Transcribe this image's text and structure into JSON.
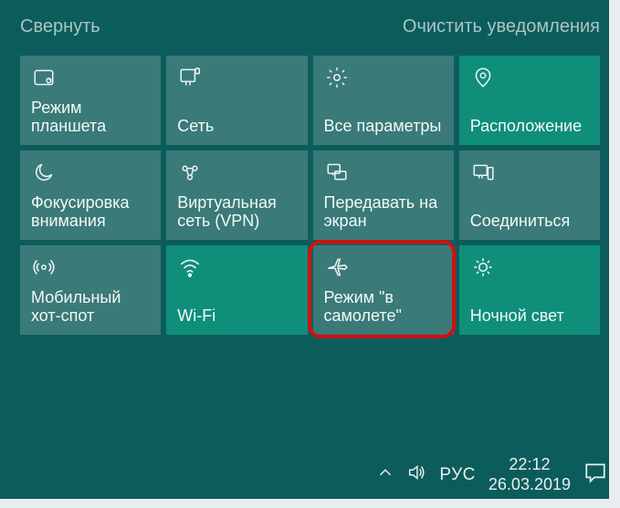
{
  "header": {
    "collapse_label": "Свернуть",
    "clear_label": "Очистить уведомления"
  },
  "tiles": [
    {
      "id": "tablet-mode",
      "label": "Режим планшета",
      "active": false
    },
    {
      "id": "network",
      "label": "Сеть",
      "active": false
    },
    {
      "id": "all-settings",
      "label": "Все параметры",
      "active": false
    },
    {
      "id": "location",
      "label": "Расположение",
      "active": true
    },
    {
      "id": "focus-assist",
      "label": "Фокусировка внимания",
      "active": false
    },
    {
      "id": "vpn",
      "label": "Виртуальная сеть (VPN)",
      "active": false
    },
    {
      "id": "project",
      "label": "Передавать на экран",
      "active": false
    },
    {
      "id": "connect",
      "label": "Соединиться",
      "active": false
    },
    {
      "id": "hotspot",
      "label": "Мобильный хот-спот",
      "active": false
    },
    {
      "id": "wifi",
      "label": "Wi-Fi",
      "active": true
    },
    {
      "id": "airplane",
      "label": "Режим \"в самолете\"",
      "active": false
    },
    {
      "id": "night-light",
      "label": "Ночной свет",
      "active": true
    }
  ],
  "highlight_tile_id": "airplane",
  "taskbar": {
    "lang": "РУС",
    "time": "22:12",
    "date": "26.03.2019"
  }
}
